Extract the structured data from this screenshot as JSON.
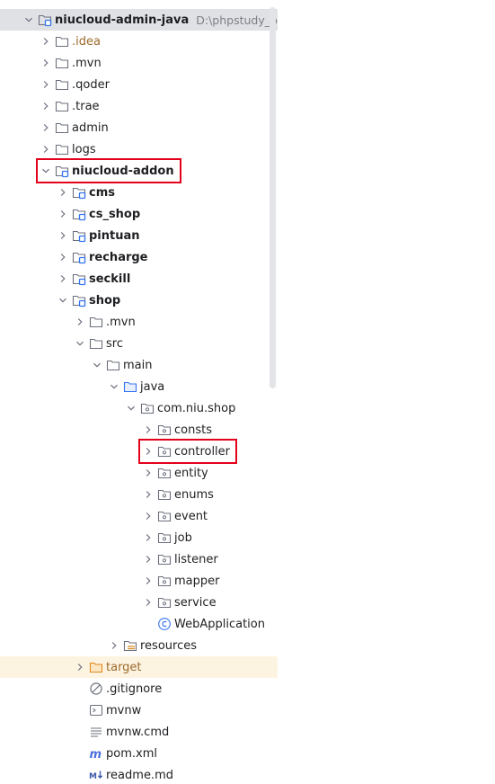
{
  "tree": {
    "rows": [
      {
        "label": "niucloud-admin-java",
        "path": "D:\\phpstudy_pro\\WWW\\",
        "depth": 0,
        "expanded": true,
        "icon": "module-folder-icon",
        "bold": true,
        "selected": true
      },
      {
        "label": ".idea",
        "depth": 1,
        "expanded": false,
        "icon": "folder-icon",
        "excluded": true
      },
      {
        "label": ".mvn",
        "depth": 1,
        "expanded": false,
        "icon": "folder-icon"
      },
      {
        "label": ".qoder",
        "depth": 1,
        "expanded": false,
        "icon": "folder-icon"
      },
      {
        "label": ".trae",
        "depth": 1,
        "expanded": false,
        "icon": "folder-icon"
      },
      {
        "label": "admin",
        "depth": 1,
        "expanded": false,
        "icon": "folder-icon"
      },
      {
        "label": "logs",
        "depth": 1,
        "expanded": false,
        "icon": "folder-icon"
      },
      {
        "label": "niucloud-addon",
        "depth": 1,
        "expanded": true,
        "icon": "module-folder-icon",
        "bold": true
      },
      {
        "label": "cms",
        "depth": 2,
        "expanded": false,
        "icon": "module-folder-icon",
        "bold": true
      },
      {
        "label": "cs_shop",
        "depth": 2,
        "expanded": false,
        "icon": "module-folder-icon",
        "bold": true
      },
      {
        "label": "pintuan",
        "depth": 2,
        "expanded": false,
        "icon": "module-folder-icon",
        "bold": true
      },
      {
        "label": "recharge",
        "depth": 2,
        "expanded": false,
        "icon": "module-folder-icon",
        "bold": true
      },
      {
        "label": "seckill",
        "depth": 2,
        "expanded": false,
        "icon": "module-folder-icon",
        "bold": true
      },
      {
        "label": "shop",
        "depth": 2,
        "expanded": true,
        "icon": "module-folder-icon",
        "bold": true
      },
      {
        "label": ".mvn",
        "depth": 3,
        "expanded": false,
        "icon": "folder-icon"
      },
      {
        "label": "src",
        "depth": 3,
        "expanded": true,
        "icon": "folder-icon"
      },
      {
        "label": "main",
        "depth": 4,
        "expanded": true,
        "icon": "folder-icon"
      },
      {
        "label": "java",
        "depth": 5,
        "expanded": true,
        "icon": "source-folder-icon"
      },
      {
        "label": "com.niu.shop",
        "depth": 6,
        "expanded": true,
        "icon": "package-icon"
      },
      {
        "label": "consts",
        "depth": 7,
        "expanded": false,
        "icon": "package-icon"
      },
      {
        "label": "controller",
        "depth": 7,
        "expanded": false,
        "icon": "package-icon"
      },
      {
        "label": "entity",
        "depth": 7,
        "expanded": false,
        "icon": "package-icon"
      },
      {
        "label": "enums",
        "depth": 7,
        "expanded": false,
        "icon": "package-icon"
      },
      {
        "label": "event",
        "depth": 7,
        "expanded": false,
        "icon": "package-icon"
      },
      {
        "label": "job",
        "depth": 7,
        "expanded": false,
        "icon": "package-icon"
      },
      {
        "label": "listener",
        "depth": 7,
        "expanded": false,
        "icon": "package-icon"
      },
      {
        "label": "mapper",
        "depth": 7,
        "expanded": false,
        "icon": "package-icon"
      },
      {
        "label": "service",
        "depth": 7,
        "expanded": false,
        "icon": "package-icon"
      },
      {
        "label": "WebApplication",
        "depth": 7,
        "leaf": true,
        "icon": "java-class-icon"
      },
      {
        "label": "resources",
        "depth": 5,
        "expanded": false,
        "icon": "resources-folder-icon"
      },
      {
        "label": "target",
        "depth": 3,
        "expanded": false,
        "icon": "excluded-folder-icon",
        "excluded": true,
        "row_style": "excluded"
      },
      {
        "label": ".gitignore",
        "depth": 3,
        "leaf": true,
        "icon": "ignore-file-icon"
      },
      {
        "label": "mvnw",
        "depth": 3,
        "leaf": true,
        "icon": "shell-script-icon"
      },
      {
        "label": "mvnw.cmd",
        "depth": 3,
        "leaf": true,
        "icon": "text-file-icon"
      },
      {
        "label": "pom.xml",
        "depth": 3,
        "leaf": true,
        "icon": "maven-icon"
      },
      {
        "label": "readme.md",
        "depth": 3,
        "leaf": true,
        "icon": "markdown-icon"
      }
    ]
  },
  "annotations": [
    {
      "name": "highlight-niucloud-addon",
      "row_index": 7
    },
    {
      "name": "highlight-controller",
      "row_index": 20
    }
  ],
  "colors": {
    "selection": "#dfe1e5",
    "excluded_row": "#fdf3e1",
    "excluded_text": "#9b6a2a",
    "highlight_border": "#e3001b",
    "icon_stroke": "#6c707e",
    "module_badge": "#3574f0"
  }
}
